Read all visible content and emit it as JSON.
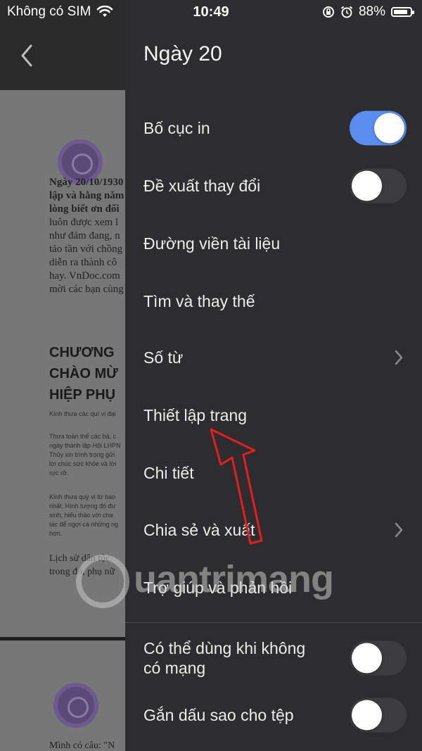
{
  "status_bar": {
    "carrier": "Không có SIM",
    "time": "10:49",
    "battery": "88%",
    "battery_level": 0.88
  },
  "document": {
    "intro_lines": [
      "Ngày 20/10/1930",
      "lập và hằng năm",
      "lòng biết ơn đối",
      "luôn được xem l",
      "như đảm đang, n",
      "tảo tần với chồng",
      "diễn ra thành cô",
      "hay. VnDoc.com",
      "mời các bạn cùng"
    ],
    "heading_lines": [
      "CHƯƠNG",
      "CHÀO MỪ",
      "HIỆP PHỤ"
    ],
    "para1": "Kính thưa các quí vị đại",
    "para2_lines": [
      "Thưa toàn thể các bà, c",
      "ngày thành lập Hội LHPN",
      "Thủy xin trình trọng gửi",
      "lời chúc sức khỏe và lời",
      "rực rỡ."
    ],
    "para3_lines": [
      "Kính thưa quý vị từ bao",
      "nhất. Hình tượng đó đư",
      "sinh, hiếu thảo với cha",
      "tác để ngợi ca những ng",
      "hơn."
    ],
    "closing_lines": [
      "Lịch sử dân tộc",
      "trong đó, phụ nữ"
    ],
    "page2_line": "Mình có câu: \"N"
  },
  "drawer": {
    "title": "Ngày 20",
    "items": [
      {
        "label": "Bố cục in",
        "control": "toggle",
        "state": true
      },
      {
        "label": "Đề xuất thay đổi",
        "control": "toggle",
        "state": false
      },
      {
        "label": "Đường viền tài liệu",
        "control": "none"
      },
      {
        "label": "Tìm và thay thế",
        "control": "none"
      },
      {
        "label": "Số từ",
        "control": "chevron"
      },
      {
        "label": "Thiết lập trang",
        "control": "none"
      },
      {
        "label": "Chi tiết",
        "control": "none"
      },
      {
        "label": "Chia sẻ và xuất",
        "control": "chevron"
      },
      {
        "label": "Trợ giúp và phản hồi",
        "control": "none"
      },
      {
        "label": "Có thể dùng khi không\ncó mạng",
        "control": "toggle",
        "state": false
      },
      {
        "label": "Gắn dấu sao cho tệp",
        "control": "toggle",
        "state": false
      }
    ]
  },
  "watermark": "uantrimang",
  "colors": {
    "drawer_bg": "#2d2d2f",
    "toggle_on": "#5b8def",
    "toggle_off": "#3d3d40",
    "annotation_arrow": "#e02020"
  }
}
